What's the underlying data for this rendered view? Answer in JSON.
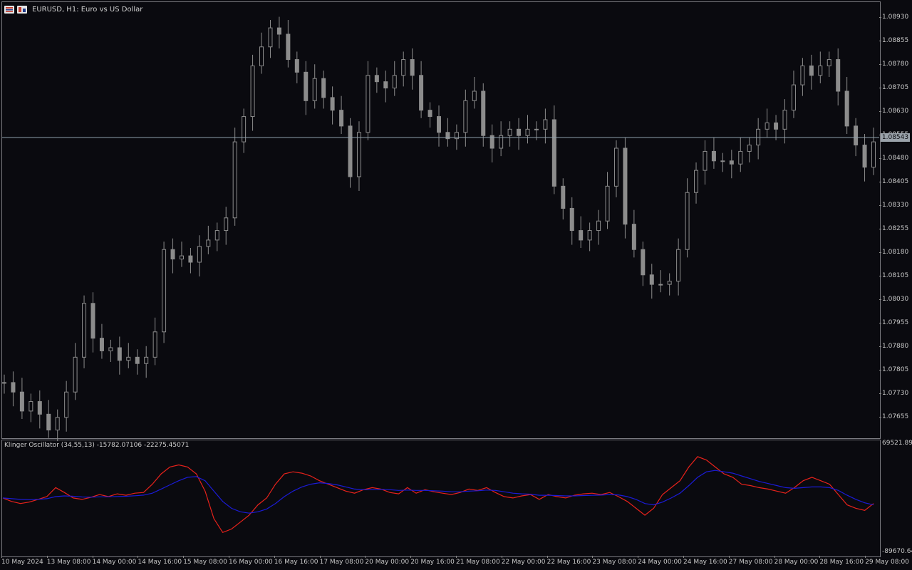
{
  "window": {
    "title": "EURUSD, H1:  Euro vs US Dollar"
  },
  "colors": {
    "background": "#0a0a0f",
    "candle": "#8c8c8c",
    "current_price_line": "#8fa0ab",
    "klinger_line": "#e8221b",
    "signal_line": "#1b1bd6"
  },
  "price_axis": {
    "labels": [
      "1.08930",
      "1.08855",
      "1.08780",
      "1.08705",
      "1.08630",
      "1.08555",
      "1.08480",
      "1.08405",
      "1.08330",
      "1.08255",
      "1.08180",
      "1.08105",
      "1.08030",
      "1.07955",
      "1.07880",
      "1.07805",
      "1.07730",
      "1.07655"
    ],
    "current_price": "1.08543"
  },
  "oscillator": {
    "title": "Klinger Oscillator (34,55,13) -15782.07106 -22275.45071",
    "axis_top": "69521.898",
    "axis_bottom": "-89670.64"
  },
  "time_axis": {
    "labels": [
      "10 May 2024",
      "13 May 08:00",
      "14 May 00:00",
      "14 May 16:00",
      "15 May 08:00",
      "16 May 00:00",
      "16 May 16:00",
      "17 May 08:00",
      "20 May 00:00",
      "20 May 16:00",
      "21 May 08:00",
      "22 May 00:00",
      "22 May 16:00",
      "23 May 08:00",
      "24 May 00:00",
      "24 May 16:00",
      "27 May 08:00",
      "28 May 00:00",
      "28 May 16:00",
      "29 May 08:00"
    ]
  },
  "chart_data": [
    {
      "type": "candlestick",
      "title": "EURUSD, H1:  Euro vs US Dollar",
      "series": [
        {
          "name": "EURUSD",
          "values": [
            1.0778,
            1.0775,
            1.0769,
            1.0772,
            1.0768,
            1.0763,
            1.0767,
            1.0775,
            1.0786,
            1.0803,
            1.0792,
            1.0788,
            1.0789,
            1.0785,
            1.0786,
            1.0784,
            1.0786,
            1.0794,
            1.082,
            1.0817,
            1.0818,
            1.0816,
            1.0821,
            1.0823,
            1.0826,
            1.083,
            1.0854,
            1.0862,
            1.0878,
            1.0884,
            1.089,
            1.0888,
            1.088,
            1.0876,
            1.0867,
            1.0874,
            1.0868,
            1.0864,
            1.0859,
            1.0843,
            1.0857,
            1.0875,
            1.0873,
            1.0871,
            1.0875,
            1.088,
            1.0875,
            1.0864,
            1.0862,
            1.0857,
            1.0855,
            1.0857,
            1.0867,
            1.087,
            1.0856,
            1.0852,
            1.0856,
            1.0858,
            1.0856,
            1.0858,
            1.0858,
            1.0861,
            1.084,
            1.0833,
            1.0826,
            1.0823,
            1.0826,
            1.0829,
            1.084,
            1.0852,
            1.0828,
            1.082,
            1.0812,
            1.0809,
            1.0809,
            1.081,
            1.082,
            1.0838,
            1.0845,
            1.0851,
            1.0848,
            1.0848,
            1.0847,
            1.0851,
            1.0853,
            1.0858,
            1.086,
            1.0858,
            1.0864,
            1.0872,
            1.0878,
            1.0875,
            1.0878,
            1.088,
            1.087,
            1.0859,
            1.0853,
            1.0846,
            1.0854
          ]
        }
      ],
      "ylim": [
        1.0762,
        1.0897
      ],
      "current_price": 1.08543
    },
    {
      "type": "line",
      "title": "Klinger Oscillator (34,55,13) -15782.07106 -22275.45071",
      "ylim": [
        -89670.64,
        69521.898
      ],
      "series": [
        {
          "name": "Klinger",
          "values": [
            -10000,
            -15000,
            -18000,
            -16000,
            -12000,
            -8000,
            5000,
            -2000,
            -10000,
            -12000,
            -9000,
            -5000,
            -8000,
            -4000,
            -6000,
            -3000,
            -2000,
            10000,
            25000,
            35000,
            38000,
            35000,
            25000,
            0,
            -40000,
            -60000,
            -55000,
            -45000,
            -35000,
            -20000,
            -10000,
            10000,
            25000,
            28000,
            26000,
            22000,
            15000,
            10000,
            5000,
            0,
            -3000,
            2000,
            5000,
            3000,
            -2000,
            -4000,
            5000,
            -3000,
            2000,
            -1000,
            -3000,
            -5000,
            -2000,
            3000,
            1000,
            5000,
            -2000,
            -8000,
            -10000,
            -7000,
            -5000,
            -12000,
            -5000,
            -8000,
            -10000,
            -6000,
            -4000,
            -3000,
            -5000,
            -2000,
            -8000,
            -15000,
            -25000,
            -35000,
            -25000,
            -5000,
            5000,
            15000,
            35000,
            50000,
            45000,
            35000,
            25000,
            20000,
            10000,
            8000,
            5000,
            3000,
            0,
            -3000,
            5000,
            15000,
            20000,
            15000,
            10000,
            -5000,
            -20000,
            -25000,
            -28000,
            -18000
          ]
        },
        {
          "name": "Signal",
          "values": [
            -10000,
            -11000,
            -12000,
            -12500,
            -12000,
            -11000,
            -8000,
            -7000,
            -7500,
            -8500,
            -8800,
            -8300,
            -8300,
            -7800,
            -7500,
            -6800,
            -5800,
            -3000,
            3000,
            9000,
            15000,
            20000,
            21000,
            15000,
            0,
            -15000,
            -25000,
            -30000,
            -32000,
            -30000,
            -26000,
            -18000,
            -8000,
            0,
            6000,
            10000,
            12000,
            11000,
            9000,
            6000,
            3000,
            2000,
            2000,
            2500,
            2000,
            1000,
            1500,
            1000,
            1000,
            500,
            0,
            -1000,
            -1000,
            0,
            500,
            1500,
            1000,
            -1000,
            -3000,
            -4000,
            -4500,
            -6000,
            -6000,
            -6500,
            -7000,
            -7000,
            -6500,
            -6000,
            -5800,
            -5000,
            -5500,
            -8000,
            -12000,
            -18000,
            -20000,
            -16000,
            -10000,
            -3000,
            8000,
            20000,
            28000,
            30000,
            28000,
            26000,
            22000,
            18000,
            14000,
            11000,
            8000,
            5000,
            4000,
            5000,
            6000,
            6000,
            5000,
            1000,
            -6000,
            -12000,
            -17000,
            -20000
          ]
        }
      ]
    }
  ]
}
